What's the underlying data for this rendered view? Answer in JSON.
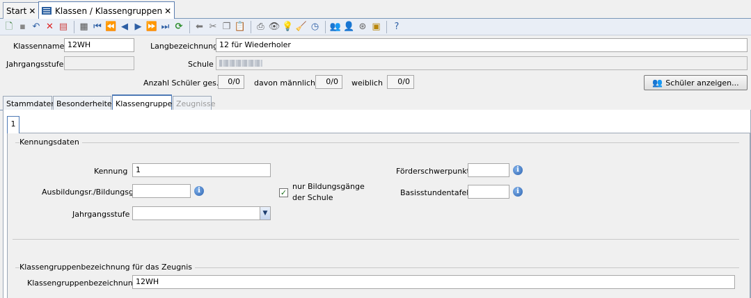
{
  "tabs": [
    {
      "label": "Start"
    },
    {
      "label": "Klassen / Klassengruppen"
    }
  ],
  "toolbar": {
    "icons": [
      "new-icon",
      "save-icon",
      "undo-icon",
      "delete-icon",
      "export-icon",
      "print-preview-icon",
      "first-icon",
      "prev-page-icon",
      "prev-icon",
      "next-icon",
      "next-page-icon",
      "last-icon",
      "refresh-icon",
      "back-arrow-icon",
      "cut-icon",
      "copy-icon",
      "paste-icon",
      "print-icon",
      "eye-icon",
      "lightbulb-icon",
      "broom-icon",
      "clock-icon",
      "users-icon",
      "user-gray-icon",
      "attachment-icon",
      "report-icon",
      "help-icon"
    ]
  },
  "header": {
    "klassenname_label": "Klassenname",
    "klassenname_value": "12WH",
    "langbezeichnung_label": "Langbezeichnung",
    "langbezeichnung_value": "12 für Wiederholer",
    "jahrgangsstufe_label": "Jahrgangsstufe",
    "jahrgangsstufe_value": "",
    "schule_label": "Schule",
    "anzahl_label": "Anzahl Schüler ges.",
    "anzahl_value": "0/0",
    "maennlich_label": "davon männlich",
    "maennlich_value": "0/0",
    "weiblich_label": "weiblich",
    "weiblich_value": "0/0",
    "show_students_button": "Schüler anzeigen..."
  },
  "section_tabs": [
    {
      "label": "Stammdaten"
    },
    {
      "label": "Besonderheiten"
    },
    {
      "label": "Klassengruppen"
    },
    {
      "label": "Zeugnisse"
    }
  ],
  "inner_tab": {
    "label": "1"
  },
  "kennungsdaten": {
    "title": "Kennungsdaten",
    "kennung_label": "Kennung",
    "kennung_value": "1",
    "ausbildung_label": "Ausbildungsr./Bildungsg.",
    "ausbildung_value": "",
    "nur_bildungsgaenge_line1": "nur Bildungsgänge",
    "nur_bildungsgaenge_line2": "der Schule",
    "nur_bildungsgaenge_checked": true,
    "jahrgangsstufe_label": "Jahrgangsstufe",
    "jahrgangsstufe_value": "",
    "foerderschwerpunkt_label": "Förderschwerpunkt",
    "foerderschwerpunkt_value": "",
    "basisstundentafel_label": "Basisstundentafel",
    "basisstundentafel_value": ""
  },
  "zeugnis": {
    "title": "Klassengruppenbezeichnung für das Zeugnis",
    "label": "Klassengruppenbezeichnung",
    "value": "12WH"
  }
}
